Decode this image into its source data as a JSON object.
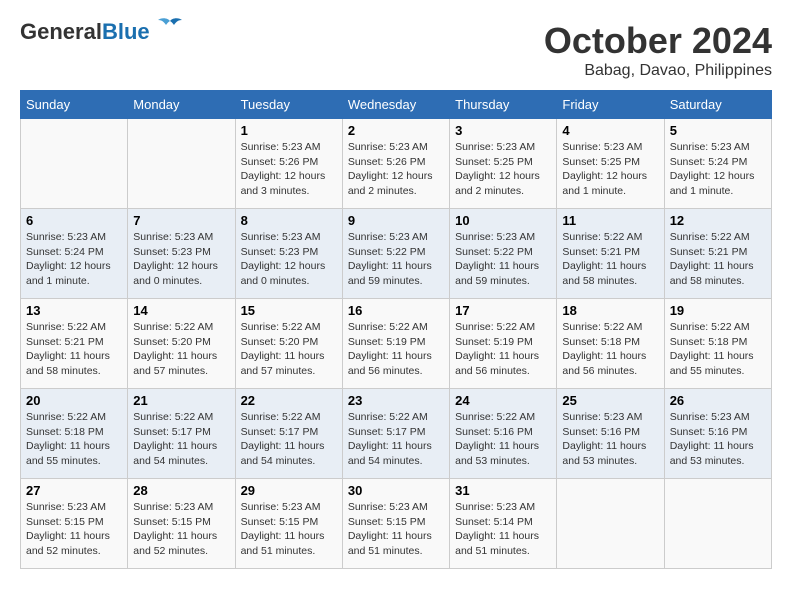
{
  "header": {
    "logo_line1": "General",
    "logo_line2": "Blue",
    "month": "October 2024",
    "location": "Babag, Davao, Philippines"
  },
  "days_of_week": [
    "Sunday",
    "Monday",
    "Tuesday",
    "Wednesday",
    "Thursday",
    "Friday",
    "Saturday"
  ],
  "weeks": [
    [
      {
        "day": "",
        "info": ""
      },
      {
        "day": "",
        "info": ""
      },
      {
        "day": "1",
        "info": "Sunrise: 5:23 AM\nSunset: 5:26 PM\nDaylight: 12 hours and 3 minutes."
      },
      {
        "day": "2",
        "info": "Sunrise: 5:23 AM\nSunset: 5:26 PM\nDaylight: 12 hours and 2 minutes."
      },
      {
        "day": "3",
        "info": "Sunrise: 5:23 AM\nSunset: 5:25 PM\nDaylight: 12 hours and 2 minutes."
      },
      {
        "day": "4",
        "info": "Sunrise: 5:23 AM\nSunset: 5:25 PM\nDaylight: 12 hours and 1 minute."
      },
      {
        "day": "5",
        "info": "Sunrise: 5:23 AM\nSunset: 5:24 PM\nDaylight: 12 hours and 1 minute."
      }
    ],
    [
      {
        "day": "6",
        "info": "Sunrise: 5:23 AM\nSunset: 5:24 PM\nDaylight: 12 hours and 1 minute."
      },
      {
        "day": "7",
        "info": "Sunrise: 5:23 AM\nSunset: 5:23 PM\nDaylight: 12 hours and 0 minutes."
      },
      {
        "day": "8",
        "info": "Sunrise: 5:23 AM\nSunset: 5:23 PM\nDaylight: 12 hours and 0 minutes."
      },
      {
        "day": "9",
        "info": "Sunrise: 5:23 AM\nSunset: 5:22 PM\nDaylight: 11 hours and 59 minutes."
      },
      {
        "day": "10",
        "info": "Sunrise: 5:23 AM\nSunset: 5:22 PM\nDaylight: 11 hours and 59 minutes."
      },
      {
        "day": "11",
        "info": "Sunrise: 5:22 AM\nSunset: 5:21 PM\nDaylight: 11 hours and 58 minutes."
      },
      {
        "day": "12",
        "info": "Sunrise: 5:22 AM\nSunset: 5:21 PM\nDaylight: 11 hours and 58 minutes."
      }
    ],
    [
      {
        "day": "13",
        "info": "Sunrise: 5:22 AM\nSunset: 5:21 PM\nDaylight: 11 hours and 58 minutes."
      },
      {
        "day": "14",
        "info": "Sunrise: 5:22 AM\nSunset: 5:20 PM\nDaylight: 11 hours and 57 minutes."
      },
      {
        "day": "15",
        "info": "Sunrise: 5:22 AM\nSunset: 5:20 PM\nDaylight: 11 hours and 57 minutes."
      },
      {
        "day": "16",
        "info": "Sunrise: 5:22 AM\nSunset: 5:19 PM\nDaylight: 11 hours and 56 minutes."
      },
      {
        "day": "17",
        "info": "Sunrise: 5:22 AM\nSunset: 5:19 PM\nDaylight: 11 hours and 56 minutes."
      },
      {
        "day": "18",
        "info": "Sunrise: 5:22 AM\nSunset: 5:18 PM\nDaylight: 11 hours and 56 minutes."
      },
      {
        "day": "19",
        "info": "Sunrise: 5:22 AM\nSunset: 5:18 PM\nDaylight: 11 hours and 55 minutes."
      }
    ],
    [
      {
        "day": "20",
        "info": "Sunrise: 5:22 AM\nSunset: 5:18 PM\nDaylight: 11 hours and 55 minutes."
      },
      {
        "day": "21",
        "info": "Sunrise: 5:22 AM\nSunset: 5:17 PM\nDaylight: 11 hours and 54 minutes."
      },
      {
        "day": "22",
        "info": "Sunrise: 5:22 AM\nSunset: 5:17 PM\nDaylight: 11 hours and 54 minutes."
      },
      {
        "day": "23",
        "info": "Sunrise: 5:22 AM\nSunset: 5:17 PM\nDaylight: 11 hours and 54 minutes."
      },
      {
        "day": "24",
        "info": "Sunrise: 5:22 AM\nSunset: 5:16 PM\nDaylight: 11 hours and 53 minutes."
      },
      {
        "day": "25",
        "info": "Sunrise: 5:23 AM\nSunset: 5:16 PM\nDaylight: 11 hours and 53 minutes."
      },
      {
        "day": "26",
        "info": "Sunrise: 5:23 AM\nSunset: 5:16 PM\nDaylight: 11 hours and 53 minutes."
      }
    ],
    [
      {
        "day": "27",
        "info": "Sunrise: 5:23 AM\nSunset: 5:15 PM\nDaylight: 11 hours and 52 minutes."
      },
      {
        "day": "28",
        "info": "Sunrise: 5:23 AM\nSunset: 5:15 PM\nDaylight: 11 hours and 52 minutes."
      },
      {
        "day": "29",
        "info": "Sunrise: 5:23 AM\nSunset: 5:15 PM\nDaylight: 11 hours and 51 minutes."
      },
      {
        "day": "30",
        "info": "Sunrise: 5:23 AM\nSunset: 5:15 PM\nDaylight: 11 hours and 51 minutes."
      },
      {
        "day": "31",
        "info": "Sunrise: 5:23 AM\nSunset: 5:14 PM\nDaylight: 11 hours and 51 minutes."
      },
      {
        "day": "",
        "info": ""
      },
      {
        "day": "",
        "info": ""
      }
    ]
  ]
}
